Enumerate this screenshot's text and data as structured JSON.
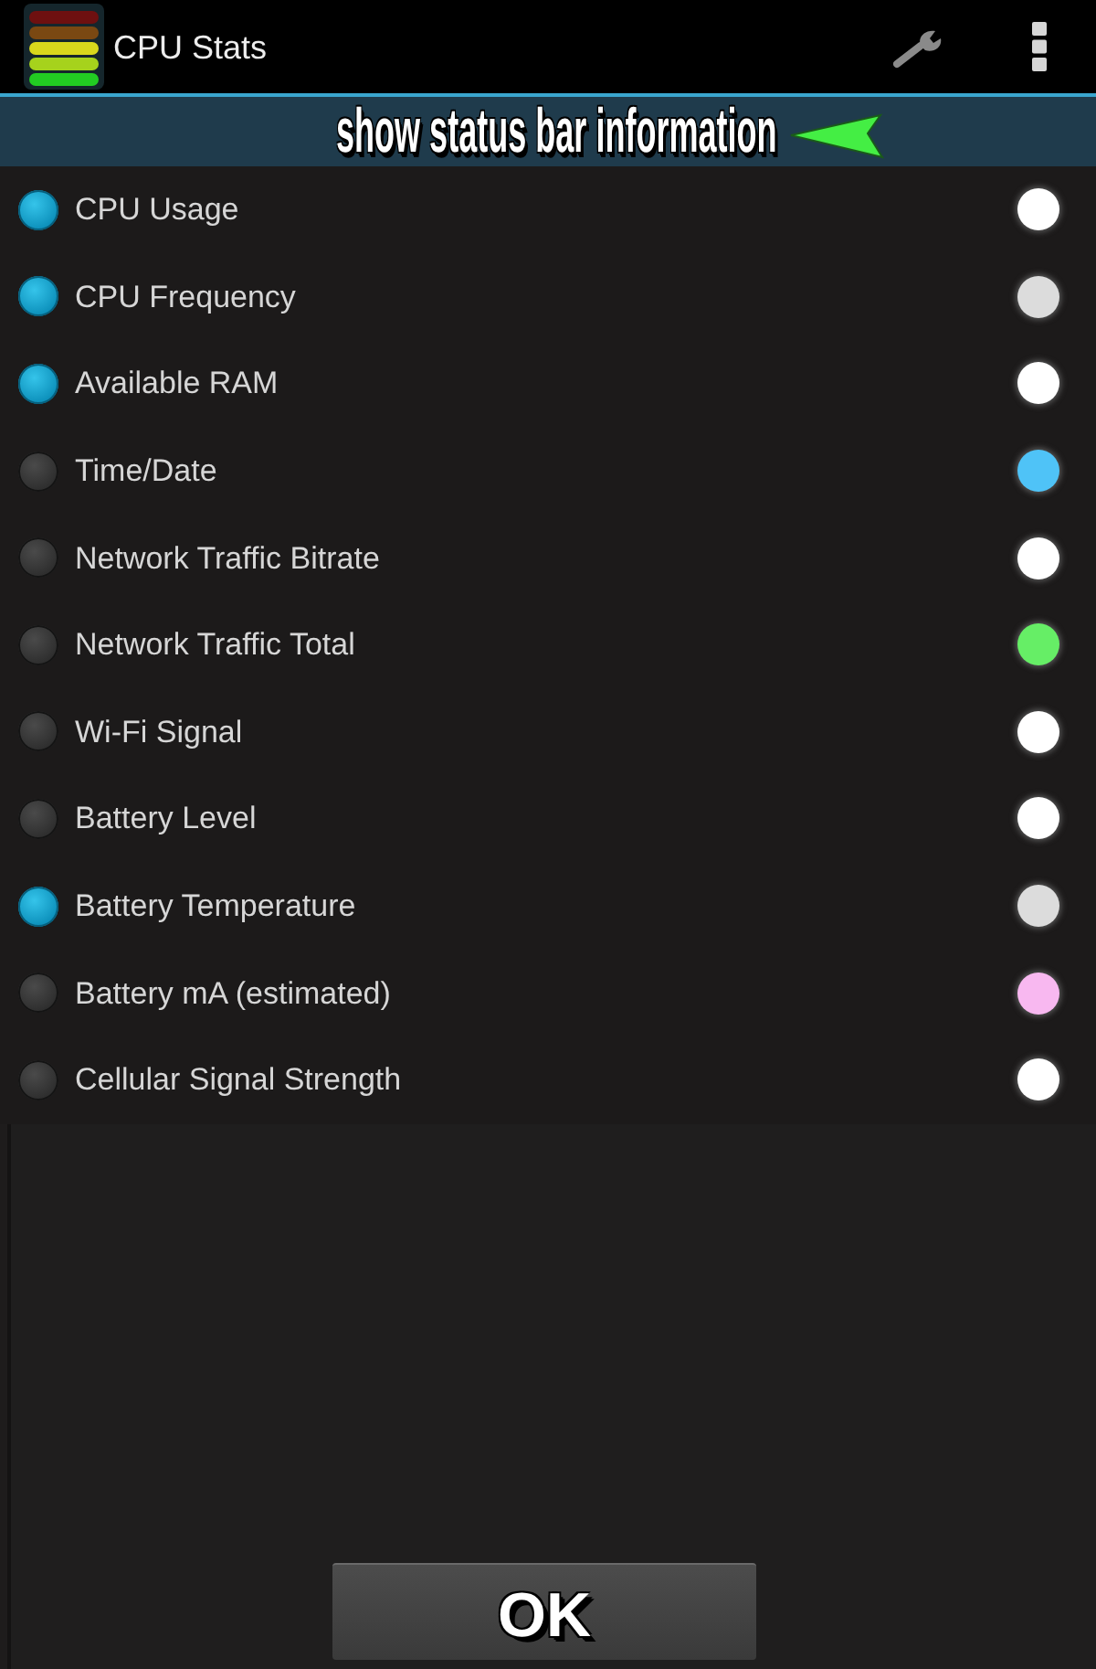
{
  "app_bar": {
    "title": "CPU Stats"
  },
  "banner": {
    "text": "show status bar information"
  },
  "items": [
    {
      "label": "CPU Usage",
      "checked": true,
      "color": "#ffffff"
    },
    {
      "label": "CPU Frequency",
      "checked": true,
      "color": "#dcdcdc"
    },
    {
      "label": "Available RAM",
      "checked": true,
      "color": "#ffffff"
    },
    {
      "label": "Time/Date",
      "checked": false,
      "color": "#4fc3f7"
    },
    {
      "label": "Network Traffic Bitrate",
      "checked": false,
      "color": "#ffffff"
    },
    {
      "label": "Network Traffic Total",
      "checked": false,
      "color": "#66ee66"
    },
    {
      "label": "Wi-Fi Signal",
      "checked": false,
      "color": "#ffffff"
    },
    {
      "label": "Battery Level",
      "checked": false,
      "color": "#ffffff"
    },
    {
      "label": "Battery Temperature",
      "checked": true,
      "color": "#dcdcdc"
    },
    {
      "label": "Battery mA (estimated)",
      "checked": false,
      "color": "#f8b8f0"
    },
    {
      "label": "Cellular Signal Strength",
      "checked": false,
      "color": "#ffffff"
    }
  ],
  "ok_button": {
    "label": "OK"
  }
}
